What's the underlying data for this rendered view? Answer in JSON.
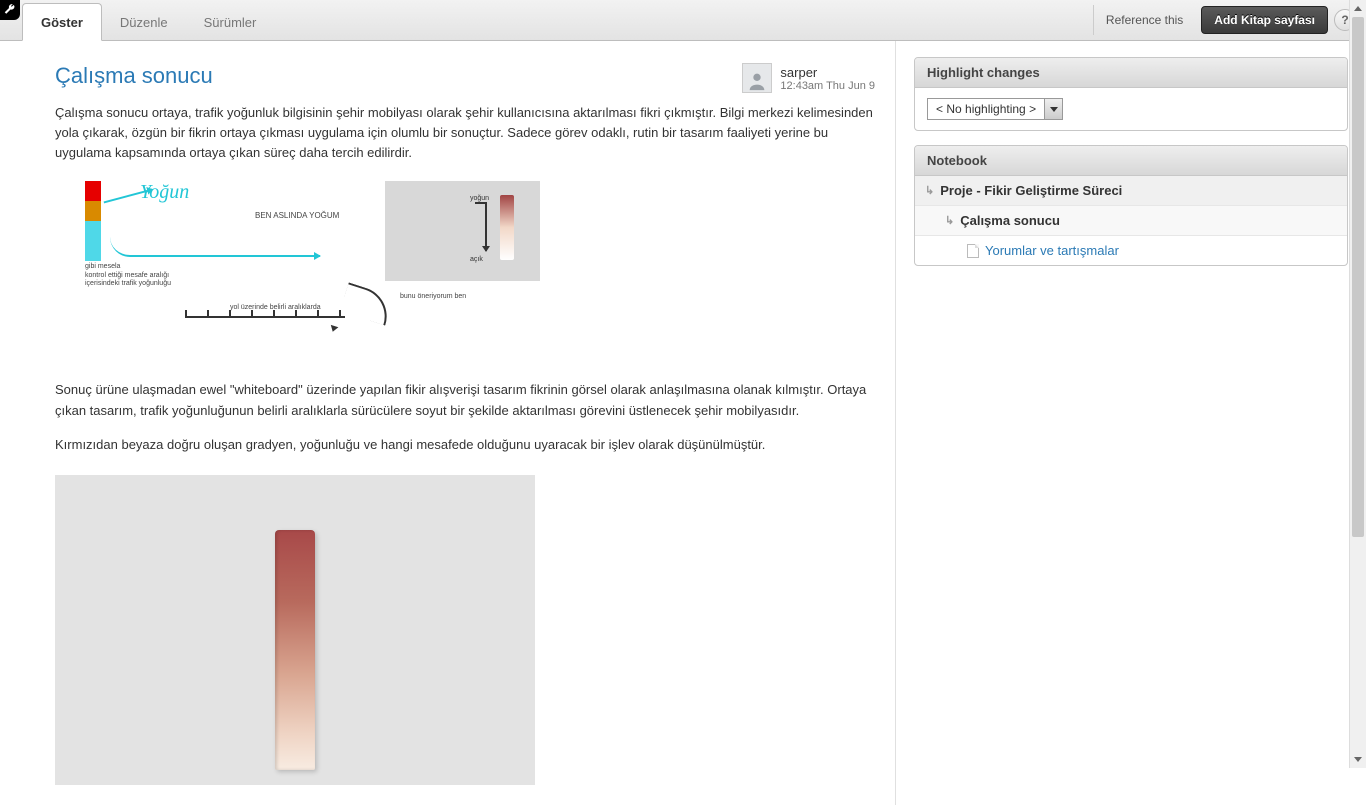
{
  "tabs": {
    "show": "Göster",
    "edit": "Düzenle",
    "versions": "Sürümler"
  },
  "topbar": {
    "reference": "Reference this",
    "add_page": "Add Kitap sayfası",
    "help": "?"
  },
  "author": {
    "name": "sarper",
    "time": "12:43am Thu Jun 9"
  },
  "page": {
    "title": "Çalışma sonucu",
    "para1": "Çalışma sonucu ortaya, trafik yoğunluk bilgisinin şehir mobilyası olarak şehir kullanıcısına aktarılması fikri çıkmıştır. Bilgi merkezi kelimesinden yola çıkarak, özgün bir fikrin ortaya çıkması uygulama için olumlu bir sonuçtur. Sadece görev odaklı, rutin bir tasarım faaliyeti yerine bu uygulama kapsamında ortaya çıkan süreç daha tercih edilirdir.",
    "para2": "Sonuç ürüne ulaşmadan ewel \"whiteboard\" üzerinde yapılan fikir alışverişi tasarım fikrinin görsel olarak anlaşılmasına olanak kılmıştır. Ortaya çıkan tasarım, trafik yoğunluğunun belirli aralıklarla sürücülere soyut bir şekilde aktarılması görevini üstlenecek şehir mobilyasıdır.",
    "para3": "Kırmızıdan beyaza doğru oluşan gradyen, yoğunluğu ve hangi mesafede olduğunu uyaracak bir işlev olarak düşünülmüştür."
  },
  "sketch": {
    "handwritten": "Yoğun",
    "caption_left": "gibi mesela\nkontrol ettiği mesafe aralığı\niçerisindeki trafik yoğunluğu",
    "caption_ruler": "yol üzerinde belirli aralıklarda",
    "caption_panel_top": "BEN ASLINDA YOĞUM",
    "caption_panel_bottom": "bunu öneriyorum ben",
    "lbl_yogun": "yoğun",
    "lbl_acik": "açık"
  },
  "sidebar": {
    "highlight_header": "Highlight changes",
    "highlight_selected": "< No highlighting >",
    "notebook_header": "Notebook",
    "tree": {
      "l0": "Proje - Fikir Geliştirme Süreci",
      "l1": "Çalışma sonucu",
      "l2": "Yorumlar ve tartışmalar"
    }
  }
}
